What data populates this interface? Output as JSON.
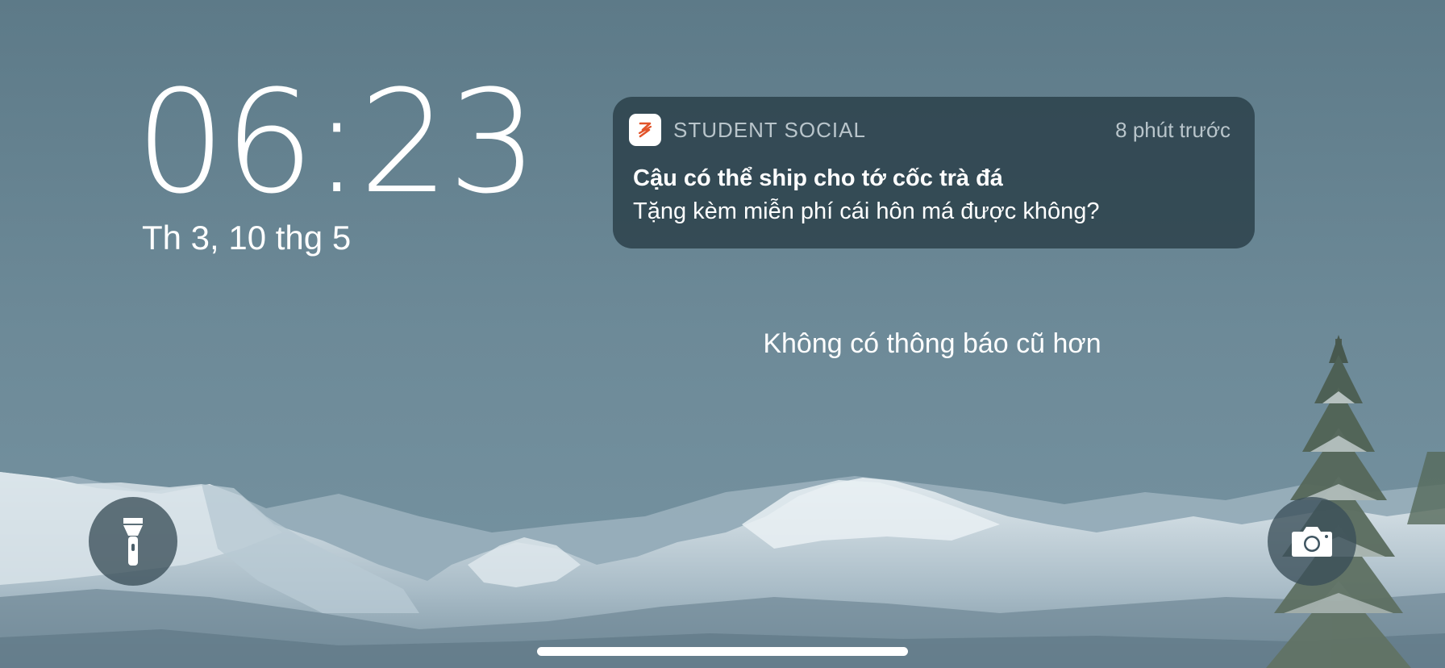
{
  "lock_screen": {
    "time": "06:23",
    "date": "Th 3, 10 thg 5"
  },
  "notification": {
    "app_name": "STUDENT SOCIAL",
    "time_ago": "8 phút trước",
    "title": "Cậu có thể ship cho tớ cốc trà đá",
    "body": "Tặng kèm miễn phí cái hôn má được không?",
    "app_icon": "student-social-logo",
    "accent_color": "#e2542a"
  },
  "status": {
    "no_older_notifications": "Không có thông báo cũ hơn"
  },
  "quick_actions": {
    "left_icon": "flashlight-icon",
    "right_icon": "camera-icon"
  }
}
